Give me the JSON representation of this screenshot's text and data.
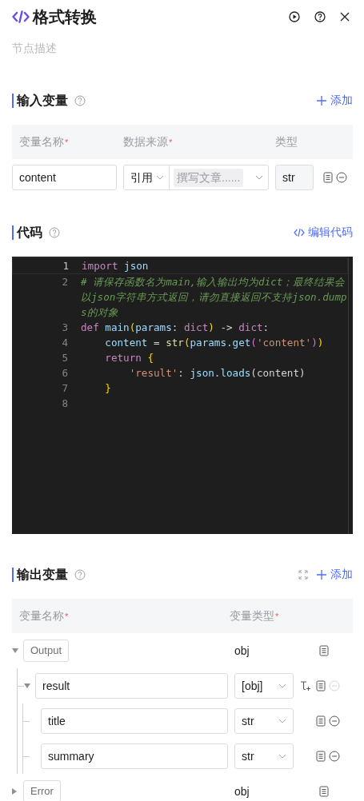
{
  "header": {
    "title": "格式转换",
    "description_placeholder": "节点描述"
  },
  "input_section": {
    "title": "输入变量",
    "add_label": "添加",
    "columns": [
      {
        "label": "变量名称",
        "required_mark": "*"
      },
      {
        "label": "数据来源",
        "required_mark": "*"
      },
      {
        "label": "类型"
      }
    ],
    "rows": [
      {
        "name": "content",
        "source_mode": "引用",
        "source_value": "撰写文章......",
        "type": "str"
      }
    ]
  },
  "code_section": {
    "title": "代码",
    "edit_label": "编辑代码",
    "lines": [
      {
        "number": "1",
        "current": true,
        "tokens": [
          {
            "kind": "keyword",
            "text": "import"
          },
          {
            "kind": "variable",
            "text": " json"
          }
        ]
      },
      {
        "number": "2",
        "current": false,
        "tokens": [
          {
            "kind": "comment",
            "text": "# 请保存函数名为main,输入输出均为dict；最终结果会以json字符串方式返回，请勿直接返回不支持json.dumps的对象"
          }
        ]
      },
      {
        "number": "3",
        "current": false,
        "tokens": [
          {
            "kind": "keyword",
            "text": "def"
          },
          {
            "kind": "variable",
            "text": " main"
          },
          {
            "kind": "bracket",
            "text": "("
          },
          {
            "kind": "variable",
            "text": "params"
          },
          {
            "kind": "plain",
            "text": ": "
          },
          {
            "kind": "builtin",
            "text": "dict"
          },
          {
            "kind": "bracket",
            "text": ")"
          },
          {
            "kind": "plain",
            "text": " -> "
          },
          {
            "kind": "builtin",
            "text": "dict"
          },
          {
            "kind": "plain",
            "text": ":"
          }
        ]
      },
      {
        "number": "4",
        "current": false,
        "tokens": [
          {
            "kind": "variable",
            "text": "    content"
          },
          {
            "kind": "plain",
            "text": " = "
          },
          {
            "kind": "function",
            "text": "str"
          },
          {
            "kind": "bracket",
            "text": "("
          },
          {
            "kind": "variable",
            "text": "params.get"
          },
          {
            "kind": "bracket2",
            "text": "("
          },
          {
            "kind": "string",
            "text": "'content'"
          },
          {
            "kind": "bracket2",
            "text": ")"
          },
          {
            "kind": "bracket",
            "text": ")"
          }
        ]
      },
      {
        "number": "5",
        "current": false,
        "tokens": [
          {
            "kind": "keyword",
            "text": "    return"
          },
          {
            "kind": "bracket",
            "text": " {"
          }
        ]
      },
      {
        "number": "6",
        "current": false,
        "tokens": [
          {
            "kind": "string",
            "text": "        'result'"
          },
          {
            "kind": "plain",
            "text": ": "
          },
          {
            "kind": "variable",
            "text": "json.loads"
          },
          {
            "kind": "plain",
            "text": "(content)"
          }
        ]
      },
      {
        "number": "7",
        "current": false,
        "tokens": [
          {
            "kind": "bracket",
            "text": "    }"
          }
        ]
      },
      {
        "number": "8",
        "current": false
      }
    ]
  },
  "output_section": {
    "title": "输出变量",
    "add_label": "添加",
    "columns": [
      {
        "label": "变量名称",
        "required_mark": "*"
      },
      {
        "label": "变量类型",
        "required_mark": "*"
      }
    ],
    "variables": [
      {
        "kind": "root",
        "name": "Output",
        "type": "obj",
        "expanded": true,
        "children": [
          {
            "kind": "field",
            "name": "result",
            "type": "[obj]",
            "expanded": true,
            "can_add_child": true,
            "remove_disabled": true,
            "children": [
              {
                "kind": "field",
                "name": "title",
                "type": "str",
                "can_add_child": false,
                "remove_disabled": false
              },
              {
                "kind": "field",
                "name": "summary",
                "type": "str",
                "can_add_child": false,
                "remove_disabled": false
              }
            ]
          }
        ]
      },
      {
        "kind": "root",
        "name": "Error",
        "type": "obj",
        "expanded": false
      }
    ]
  }
}
